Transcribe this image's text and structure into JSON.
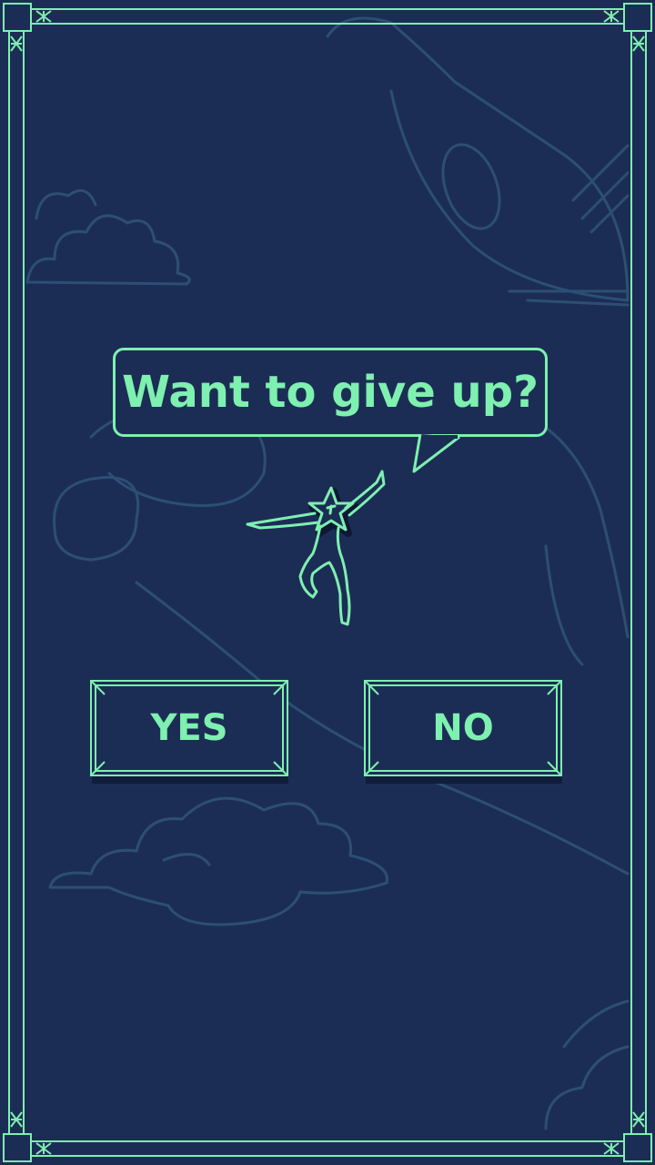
{
  "dialog": {
    "question": "Want to give up?"
  },
  "buttons": {
    "yes_label": "YES",
    "no_label": "NO"
  },
  "colors": {
    "background": "#1c2d55",
    "accent": "#7ef0b0",
    "sketch": "#2a4d70"
  },
  "icons": {
    "character": "star-head-stickman-icon"
  }
}
